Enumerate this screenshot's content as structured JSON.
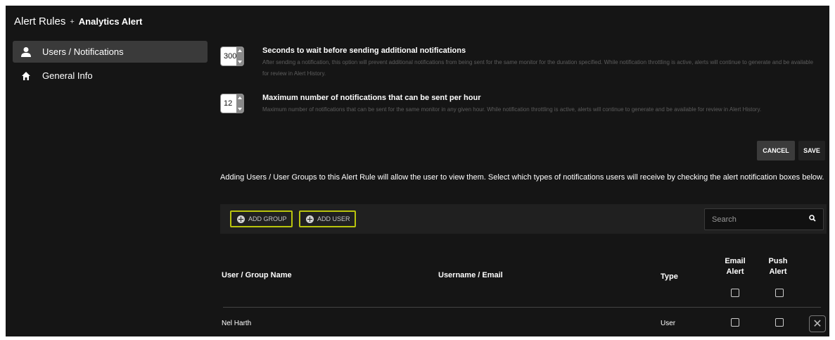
{
  "breadcrumb": {
    "root": "Alert Rules",
    "separator": "+",
    "current": "Analytics Alert"
  },
  "sidebar": {
    "items": [
      {
        "label": "Users / Notifications",
        "icon": "user-icon",
        "active": true
      },
      {
        "label": "General Info",
        "icon": "home-icon",
        "active": false
      }
    ]
  },
  "settings": [
    {
      "value": "300",
      "title": "Seconds to wait before sending additional notifications",
      "description": "After sending a notification, this option will prevent additional notifications from being sent for the same monitor for the duration specified. While notification throttling is active, alerts will continue to generate and be available for review in Alert History."
    },
    {
      "value": "12",
      "title": "Maximum number of notifications that can be sent per hour",
      "description": "Maximum number of notifications that can be sent for the same monitor in any given hour. While notification throttling is active, alerts will continue to generate and be available for review in Alert History."
    }
  ],
  "actions": {
    "cancel": "CANCEL",
    "save": "SAVE"
  },
  "info_text": "Adding Users / User Groups to this Alert Rule will allow the user to view them. Select which types of notifications users will receive by checking the alert notification boxes below.",
  "toolbar": {
    "add_group": "ADD GROUP",
    "add_user": "ADD USER",
    "search_placeholder": "Search"
  },
  "table": {
    "headers": {
      "name": "User / Group Name",
      "email": "Username / Email",
      "type": "Type",
      "email_alert": "Email Alert",
      "push_alert": "Push Alert"
    },
    "rows": [
      {
        "name": "Nel Harth",
        "email": "",
        "type": "User",
        "email_alert": false,
        "push_alert": false
      }
    ]
  },
  "colors": {
    "background": "#151515",
    "accent": "#b9c40d",
    "active_item": "#3a3a3a"
  }
}
